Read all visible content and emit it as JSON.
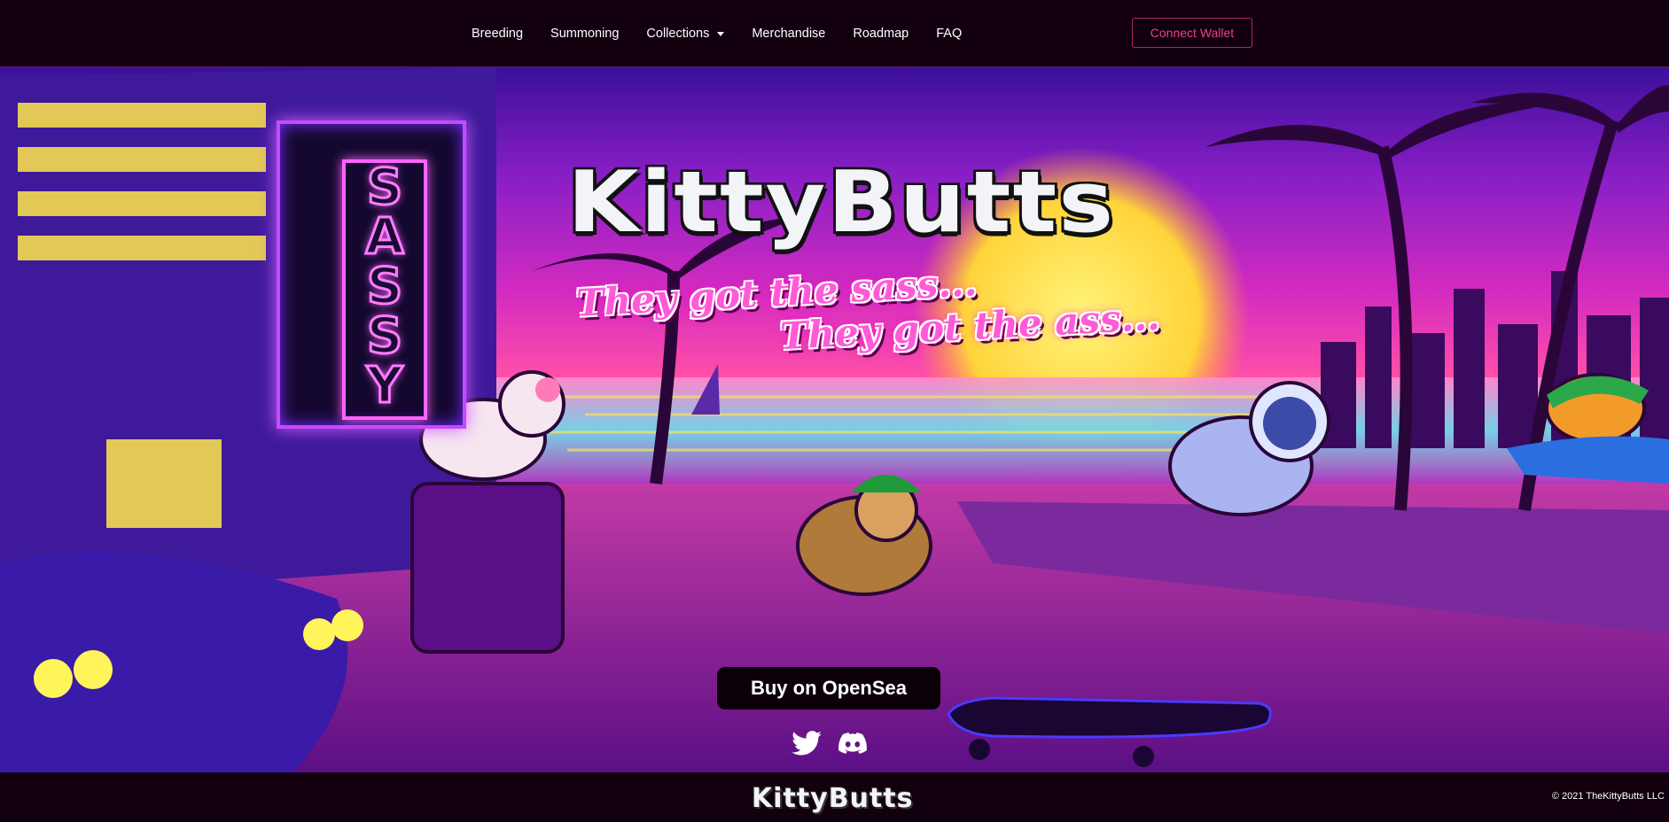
{
  "nav": {
    "links": [
      {
        "label": "Breeding"
      },
      {
        "label": "Summoning"
      },
      {
        "label": "Collections",
        "has_dropdown": true
      },
      {
        "label": "Merchandise"
      },
      {
        "label": "Roadmap"
      },
      {
        "label": "FAQ"
      }
    ],
    "connect_wallet_label": "Connect Wallet"
  },
  "hero": {
    "logo_text": "KittyButts",
    "tagline_line1": "They got the sass...",
    "tagline_line2": "They got the ass...",
    "sign_text": "SASSY",
    "buy_button_label": "Buy on OpenSea",
    "social_icons": [
      "twitter-icon",
      "discord-icon"
    ]
  },
  "footer": {
    "logo_text": "KittyButts",
    "copyright": "© 2021 TheKittyButts LLC"
  },
  "colors": {
    "nav_bg": "#12000f",
    "wallet_accent": "#e3467e",
    "neon_pink": "#ff5bd8",
    "sunset_yellow": "#ffcb3a"
  }
}
